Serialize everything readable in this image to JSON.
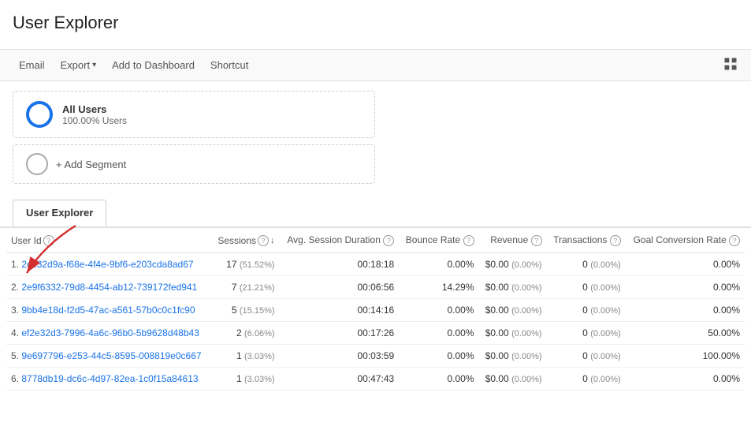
{
  "header": {
    "title": "User Explorer"
  },
  "toolbar": {
    "email": "Email",
    "export": "Export",
    "add_to_dashboard": "Add to Dashboard",
    "shortcut": "Shortcut"
  },
  "segments": [
    {
      "name": "All Users",
      "sub": "100.00% Users"
    }
  ],
  "add_segment_label": "+ Add Segment",
  "tab": "User Explorer",
  "table": {
    "columns": [
      {
        "key": "user_id",
        "label": "User Id",
        "has_help": true
      },
      {
        "key": "sessions",
        "label": "Sessions",
        "has_help": true,
        "sortable": true
      },
      {
        "key": "avg_session",
        "label": "Avg. Session Duration",
        "has_help": true
      },
      {
        "key": "bounce_rate",
        "label": "Bounce Rate",
        "has_help": true
      },
      {
        "key": "revenue",
        "label": "Revenue",
        "has_help": true
      },
      {
        "key": "transactions",
        "label": "Transactions",
        "has_help": true
      },
      {
        "key": "goal_conversion",
        "label": "Goal Conversion Rate",
        "has_help": true
      }
    ],
    "rows": [
      {
        "num": "1.",
        "user_id": "2c132d9a-f68e-4f4e-9bf6-e203cda8ad67",
        "sessions": "17",
        "sessions_pct": "51.52%",
        "avg_session": "00:18:18",
        "bounce_rate": "0.00%",
        "revenue": "$0.00",
        "revenue_pct": "0.00%",
        "transactions": "0",
        "transactions_pct": "0.00%",
        "goal_conversion": "0.00%"
      },
      {
        "num": "2.",
        "user_id": "2e9f6332-79d8-4454-ab12-739172fed941",
        "sessions": "7",
        "sessions_pct": "21.21%",
        "avg_session": "00:06:56",
        "bounce_rate": "14.29%",
        "revenue": "$0.00",
        "revenue_pct": "0.00%",
        "transactions": "0",
        "transactions_pct": "0.00%",
        "goal_conversion": "0.00%"
      },
      {
        "num": "3.",
        "user_id": "9bb4e18d-f2d5-47ac-a561-57b0c0c1fc90",
        "sessions": "5",
        "sessions_pct": "15.15%",
        "avg_session": "00:14:16",
        "bounce_rate": "0.00%",
        "revenue": "$0.00",
        "revenue_pct": "0.00%",
        "transactions": "0",
        "transactions_pct": "0.00%",
        "goal_conversion": "0.00%"
      },
      {
        "num": "4.",
        "user_id": "ef2e32d3-7996-4a6c-96b0-5b9628d48b43",
        "sessions": "2",
        "sessions_pct": "6.06%",
        "avg_session": "00:17:26",
        "bounce_rate": "0.00%",
        "revenue": "$0.00",
        "revenue_pct": "0.00%",
        "transactions": "0",
        "transactions_pct": "0.00%",
        "goal_conversion": "50.00%"
      },
      {
        "num": "5.",
        "user_id": "9e697796-e253-44c5-8595-008819e0c667",
        "sessions": "1",
        "sessions_pct": "3.03%",
        "avg_session": "00:03:59",
        "bounce_rate": "0.00%",
        "revenue": "$0.00",
        "revenue_pct": "0.00%",
        "transactions": "0",
        "transactions_pct": "0.00%",
        "goal_conversion": "100.00%"
      },
      {
        "num": "6.",
        "user_id": "8778db19-dc6c-4d97-82ea-1c0f15a84613",
        "sessions": "1",
        "sessions_pct": "3.03%",
        "avg_session": "00:47:43",
        "bounce_rate": "0.00%",
        "revenue": "$0.00",
        "revenue_pct": "0.00%",
        "transactions": "0",
        "transactions_pct": "0.00%",
        "goal_conversion": "0.00%"
      }
    ]
  }
}
